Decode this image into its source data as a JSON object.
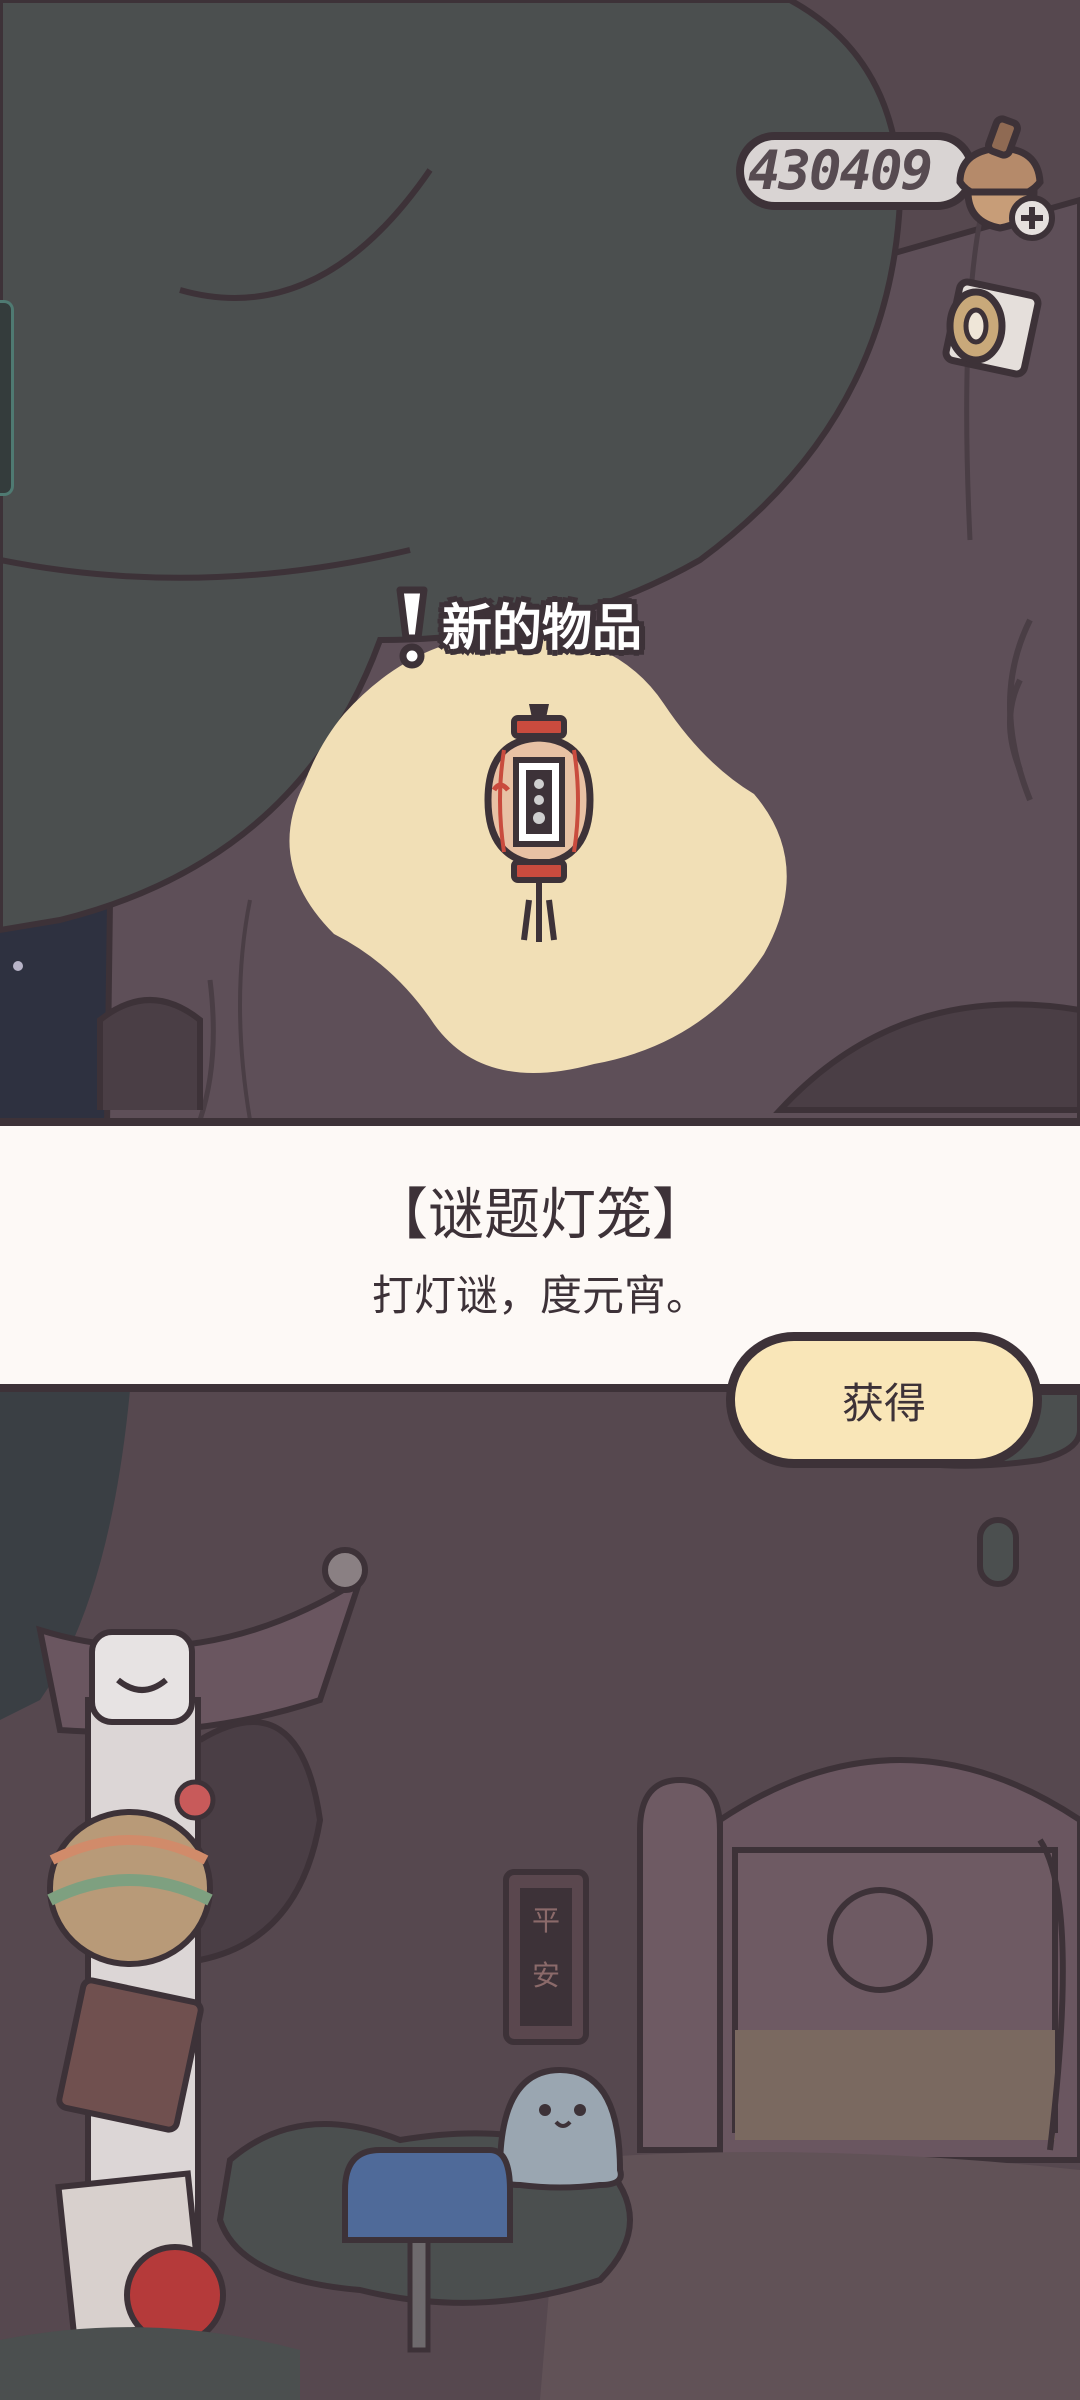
{
  "currency": {
    "amount": "430409",
    "icon": "acorn-plus-icon"
  },
  "popup": {
    "header": "新的物品",
    "item_icon": "paper-lantern-icon",
    "item_name": "【谜题灯笼】",
    "item_description": "打灯谜，度元宵。",
    "obtain_button": "获得"
  },
  "scene": {
    "sign_text": "平安",
    "icons": [
      "reel-icon",
      "mailbox-icon",
      "ghost-character",
      "tree-house-door",
      "side-menu-tab"
    ]
  },
  "colors": {
    "outline": "#3d3238",
    "blob": "#f1dfb6",
    "banner": "#fdf9f6",
    "button": "#f9e6b8",
    "foliage": "#4b4f4f",
    "trunk": "#5e4f58"
  }
}
